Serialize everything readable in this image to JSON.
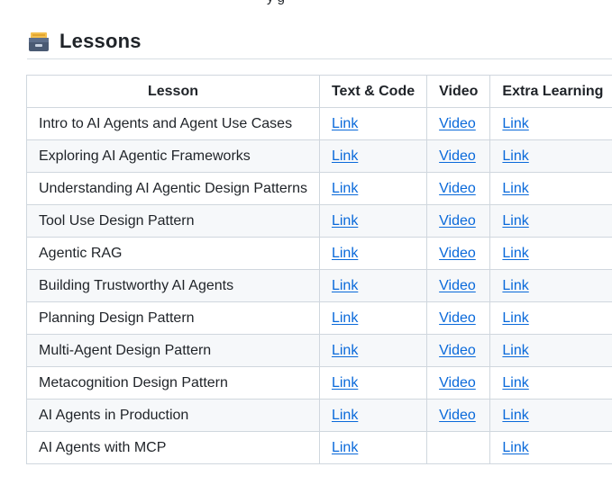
{
  "top_fragment": "y      g",
  "heading": {
    "icon": "card-file-box-icon",
    "title": "Lessons"
  },
  "table": {
    "headers": [
      "Lesson",
      "Text & Code",
      "Video",
      "Extra Learning"
    ],
    "rows": [
      {
        "lesson": "Intro to AI Agents and Agent Use Cases",
        "text_code": "Link",
        "video": "Video",
        "extra": "Link"
      },
      {
        "lesson": "Exploring AI Agentic Frameworks",
        "text_code": "Link",
        "video": "Video",
        "extra": "Link"
      },
      {
        "lesson": "Understanding AI Agentic Design Patterns",
        "text_code": "Link",
        "video": "Video",
        "extra": "Link"
      },
      {
        "lesson": "Tool Use Design Pattern",
        "text_code": "Link",
        "video": "Video",
        "extra": "Link"
      },
      {
        "lesson": "Agentic RAG",
        "text_code": "Link",
        "video": "Video",
        "extra": "Link"
      },
      {
        "lesson": "Building Trustworthy AI Agents",
        "text_code": "Link",
        "video": "Video",
        "extra": "Link"
      },
      {
        "lesson": "Planning Design Pattern",
        "text_code": "Link",
        "video": "Video",
        "extra": "Link"
      },
      {
        "lesson": "Multi-Agent Design Pattern",
        "text_code": "Link",
        "video": "Video",
        "extra": "Link"
      },
      {
        "lesson": "Metacognition Design Pattern",
        "text_code": "Link",
        "video": "Video",
        "extra": "Link"
      },
      {
        "lesson": "AI Agents in Production",
        "text_code": "Link",
        "video": "Video",
        "extra": "Link"
      },
      {
        "lesson": "AI Agents with MCP",
        "text_code": "Link",
        "video": "",
        "extra": "Link"
      }
    ]
  },
  "colors": {
    "link": "#0969da",
    "border": "#d0d7de",
    "stripe": "#f6f8fa",
    "text": "#1f2328"
  }
}
